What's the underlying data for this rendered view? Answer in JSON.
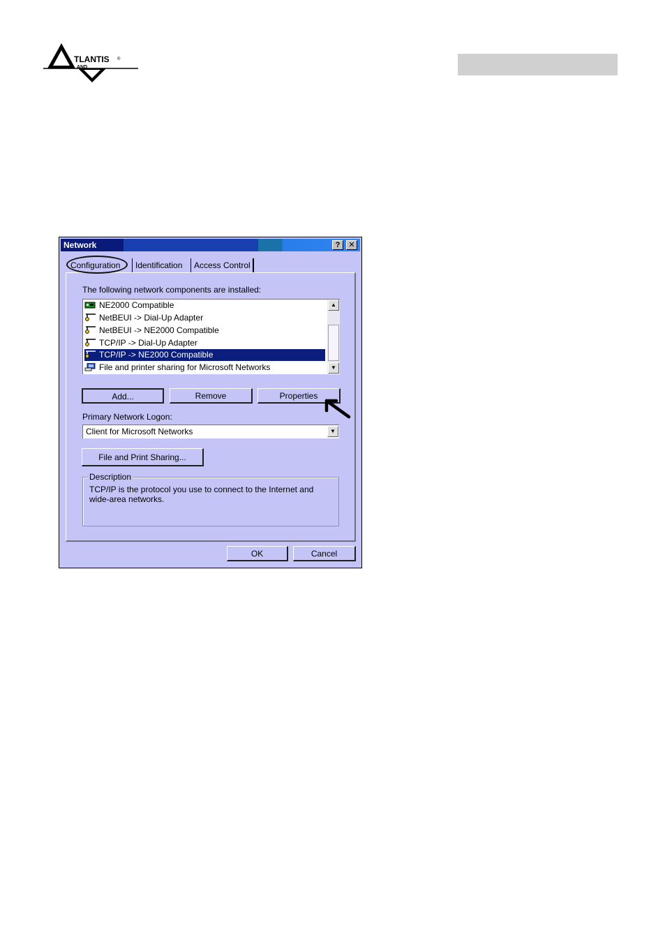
{
  "logo": {
    "text": "TLANTIS",
    "subtext": "AND",
    "mark": "®"
  },
  "dialog": {
    "title": "Network",
    "help_label": "?",
    "close_label": "✕",
    "tabs": [
      "Configuration",
      "Identification",
      "Access Control"
    ],
    "active_tab": "Configuration",
    "components_label": "The following network components are installed:",
    "components": [
      {
        "label": "NE2000 Compatible",
        "icon": "network-card-icon",
        "selected": false
      },
      {
        "label": "NetBEUI -> Dial-Up Adapter",
        "icon": "protocol-icon",
        "selected": false
      },
      {
        "label": "NetBEUI -> NE2000 Compatible",
        "icon": "protocol-icon",
        "selected": false
      },
      {
        "label": "TCP/IP -> Dial-Up Adapter",
        "icon": "protocol-icon",
        "selected": false
      },
      {
        "label": "TCP/IP -> NE2000 Compatible",
        "icon": "protocol-icon",
        "selected": true
      },
      {
        "label": "File and printer sharing for Microsoft Networks",
        "icon": "file-sharing-icon",
        "selected": false
      }
    ],
    "add_label": "Add...",
    "remove_label": "Remove",
    "properties_label": "Properties",
    "logon_label": "Primary Network Logon:",
    "logon_value": "Client for Microsoft Networks",
    "share_label": "File and Print Sharing...",
    "description_legend": "Description",
    "description_text": "TCP/IP is the protocol you use to connect to the Internet and wide-area networks.",
    "ok_label": "OK",
    "cancel_label": "Cancel"
  },
  "colors": {
    "dialog_bg": "#c4c4f6",
    "selection": "#0b1e7e",
    "titlebar": "#0a1a7a",
    "header_bar": "#d0d0d0"
  }
}
